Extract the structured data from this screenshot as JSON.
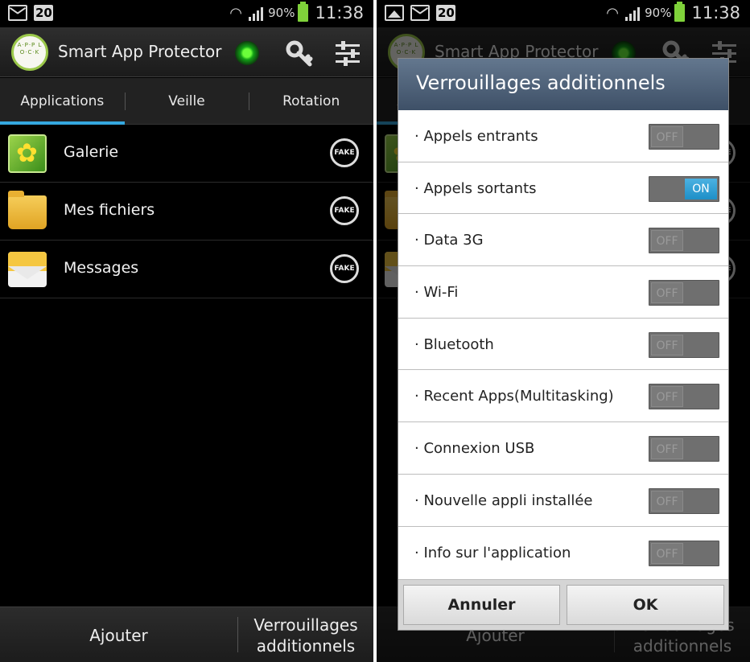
{
  "status_bar": {
    "calendar_day": "20",
    "battery": "90%",
    "time": "11:38"
  },
  "app": {
    "title": "Smart App Protector",
    "logo_text": "A·P·P L O·C·K"
  },
  "tabs": [
    {
      "label": "Applications",
      "active": true
    },
    {
      "label": "Veille",
      "active": false
    },
    {
      "label": "Rotation",
      "active": false
    }
  ],
  "apps": [
    {
      "name": "Galerie",
      "icon": "gallery-icon",
      "badge": "FAKE"
    },
    {
      "name": "Mes fichiers",
      "icon": "folder-icon",
      "badge": "FAKE"
    },
    {
      "name": "Messages",
      "icon": "message-icon",
      "badge": "FAKE"
    }
  ],
  "bottom_bar": {
    "add_label": "Ajouter",
    "more_label_line1": "Verrouillages",
    "more_label_line2": "additionnels"
  },
  "dialog": {
    "title": "Verrouillages additionnels",
    "options": [
      {
        "label": "· Appels entrants",
        "state": "OFF"
      },
      {
        "label": "· Appels sortants",
        "state": "ON"
      },
      {
        "label": "· Data 3G",
        "state": "OFF"
      },
      {
        "label": "· Wi-Fi",
        "state": "OFF"
      },
      {
        "label": "· Bluetooth",
        "state": "OFF"
      },
      {
        "label": "· Recent Apps(Multitasking)",
        "state": "OFF"
      },
      {
        "label": "· Connexion USB",
        "state": "OFF"
      },
      {
        "label": "· Nouvelle appli installée",
        "state": "OFF"
      },
      {
        "label": "· Info sur l'application",
        "state": "OFF"
      }
    ],
    "cancel_label": "Annuler",
    "ok_label": "OK"
  },
  "colors": {
    "accent_blue": "#35a8df",
    "toggle_on": "#1d8fc7",
    "status_green": "#6bff3a",
    "battery_green": "#7fd23a",
    "dialog_title_bg": "#4e6178"
  }
}
